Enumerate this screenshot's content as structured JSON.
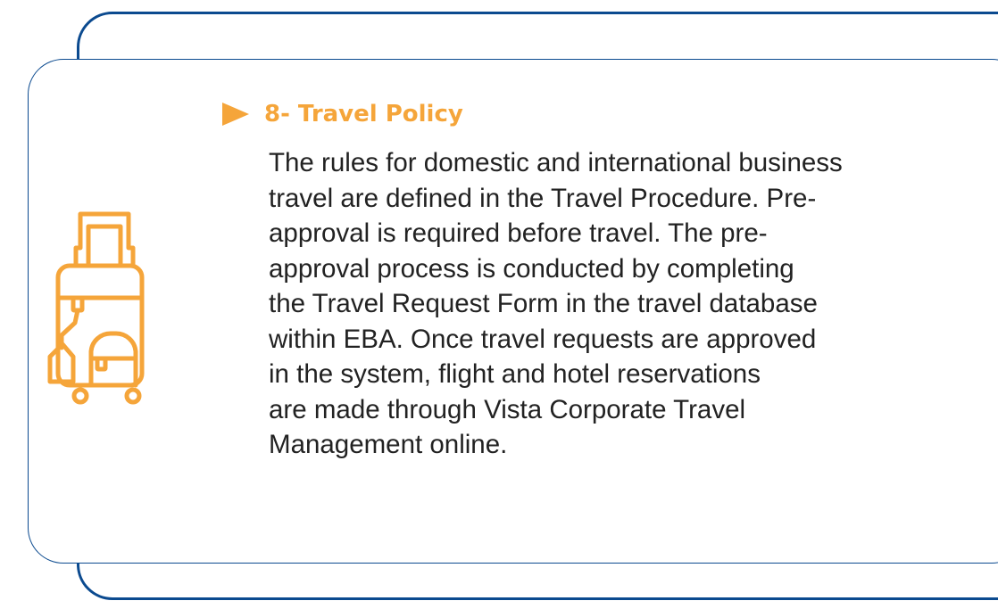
{
  "colors": {
    "accent": "#f5a53a",
    "frame": "#0b4a8f",
    "text": "#222222"
  },
  "section": {
    "heading": "8- Travel Policy",
    "icon": "luggage-icon",
    "bullet_icon": "triangle-bullet-icon",
    "lines": [
      "The rules for domestic and international business",
      "travel are defined in the Travel Procedure. Pre-",
      "approval is required before travel. The pre-",
      "approval process is conducted by completing",
      "the Travel Request Form in the travel database",
      "within EBA. Once travel requests are approved",
      "in the system, flight and hotel reservations",
      "are made through Vista Corporate Travel",
      "Management online."
    ]
  }
}
